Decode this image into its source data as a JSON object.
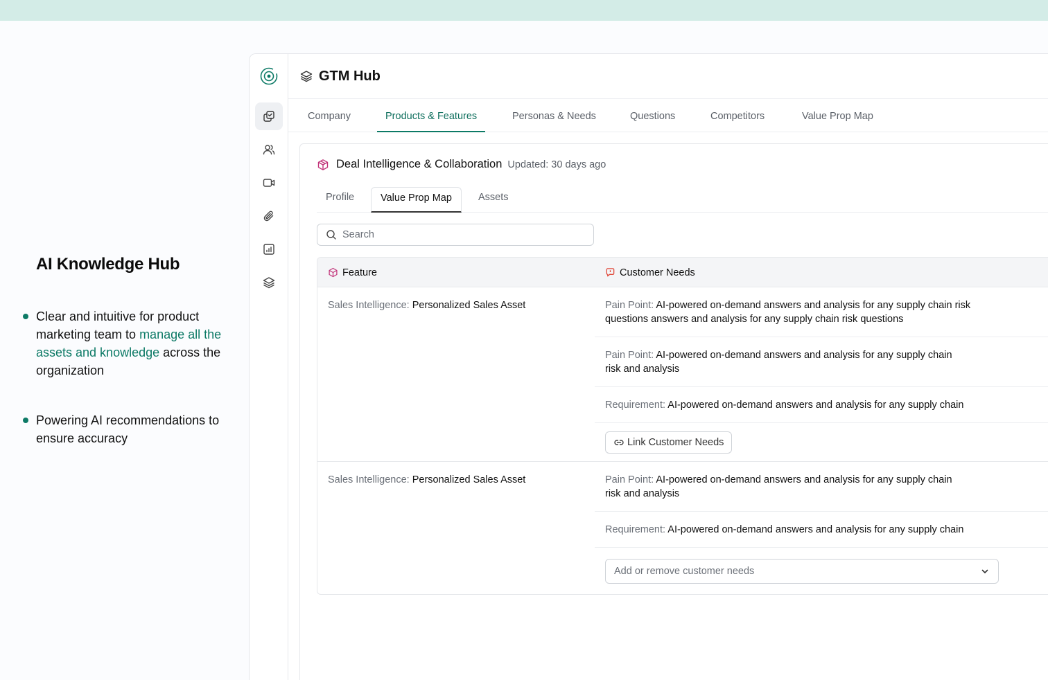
{
  "promo": {
    "title": "AI Knowledge Hub",
    "bullet1_pre": "Clear and intuitive for product marketing team to ",
    "bullet1_accent": "manage all the assets and knowledge",
    "bullet1_post": " across the organization",
    "bullet2": "Powering AI recommendations to ensure accuracy",
    "accent_color": "#0d7a66"
  },
  "header": {
    "title": "GTM Hub"
  },
  "tabs": [
    {
      "label": "Company"
    },
    {
      "label": "Products & Features"
    },
    {
      "label": "Personas & Needs"
    },
    {
      "label": "Questions"
    },
    {
      "label": "Competitors"
    },
    {
      "label": "Value Prop Map"
    }
  ],
  "active_tab": "Products & Features",
  "product": {
    "title": "Deal Intelligence & Collaboration",
    "updated": "Updated: 30 days ago"
  },
  "subtabs": [
    {
      "label": "Profile"
    },
    {
      "label": "Value Prop Map"
    },
    {
      "label": "Assets"
    }
  ],
  "active_subtab": "Value Prop Map",
  "search": {
    "placeholder": "Search"
  },
  "table": {
    "col_feature": "Feature",
    "col_needs": "Customer Needs",
    "rows": [
      {
        "feature_prefix": "Sales Intelligence:",
        "feature_name": "Personalized Sales Asset",
        "needs": [
          {
            "kind": "Pain Point:",
            "text": "AI-powered on-demand answers and analysis for any supply chain risk questions answers and analysis for any supply chain risk questions"
          },
          {
            "kind": "Pain Point:",
            "text": "AI-powered on-demand answers and analysis for any supply chain risk and analysis"
          },
          {
            "kind": "Requirement:",
            "text": "AI-powered on-demand answers and analysis for any supply chain"
          }
        ],
        "action_label": "Link Customer Needs"
      },
      {
        "feature_prefix": "Sales Intelligence:",
        "feature_name": "Personalized Sales Asset",
        "needs": [
          {
            "kind": "Pain Point:",
            "text": "AI-powered on-demand answers and analysis for any supply chain risk and analysis"
          },
          {
            "kind": "Requirement:",
            "text": "AI-powered on-demand answers and analysis for any supply chain"
          }
        ],
        "select_placeholder": "Add or remove customer needs"
      }
    ]
  },
  "colors": {
    "brand": "#0d7a66",
    "product_icon": "#c2347a",
    "needs_icon": "#e0493b",
    "top_strip": "#d3ece7"
  },
  "icons": {
    "logo": "target-logo-icon",
    "rail": [
      "copy-check-icon",
      "users-icon",
      "video-icon",
      "paperclip-icon",
      "bar-chart-icon",
      "layers-icon"
    ],
    "header": "layers-icon",
    "product": "box-icon",
    "feature_col": "box-icon",
    "needs_col": "message-alert-icon",
    "search": "search-icon",
    "link": "link-icon",
    "select": "chevron-down-icon"
  }
}
